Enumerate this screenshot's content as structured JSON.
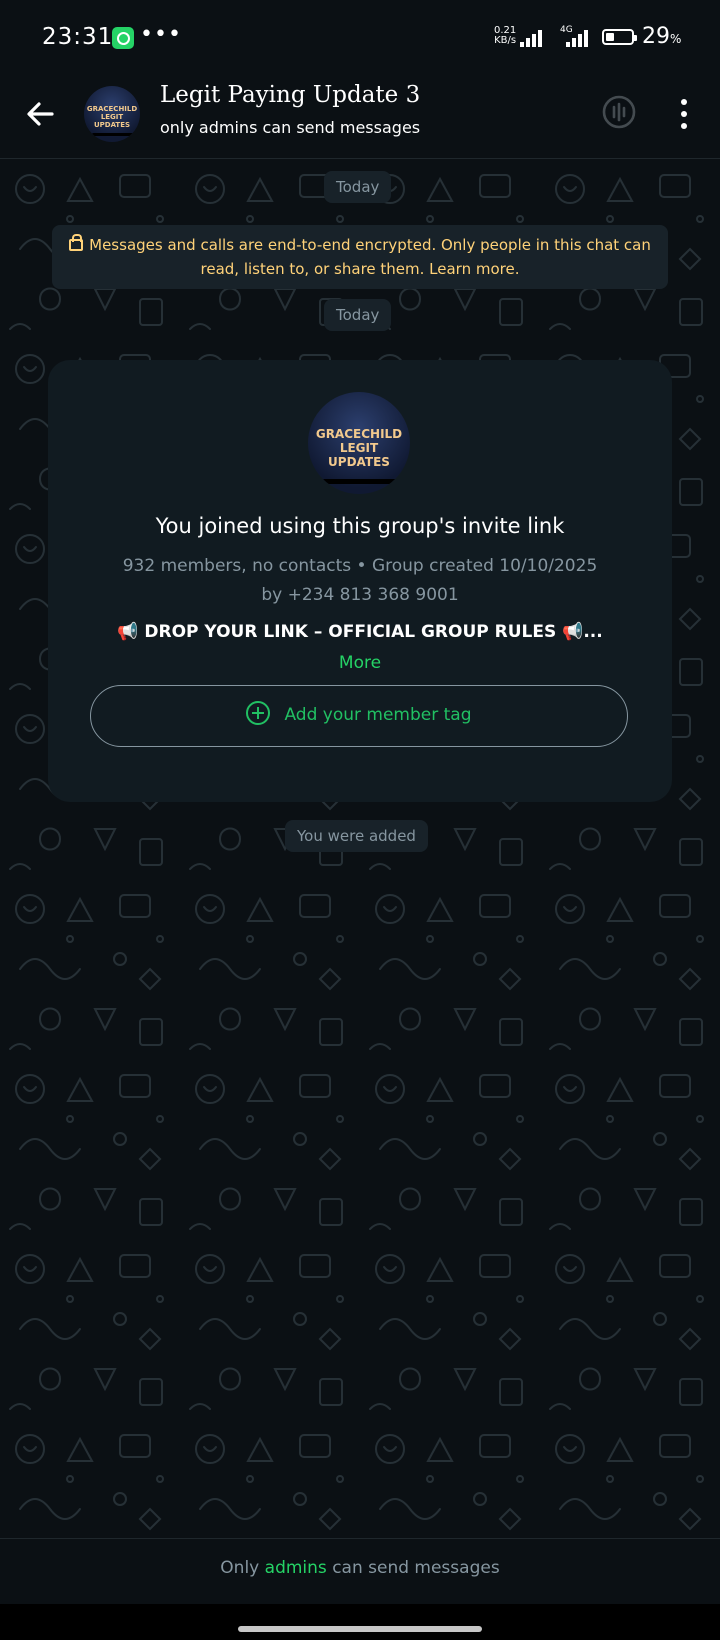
{
  "status_bar": {
    "time": "23:31",
    "more": "•••",
    "net_speed": "0.21",
    "net_unit": "KB/s",
    "network": "4G",
    "battery_value": "29",
    "battery_unit": "%"
  },
  "header": {
    "title": "Legit Paying Update 3",
    "subtitle": "only admins can send messages",
    "avatar_text": "GRACECHILD LEGIT UPDATES",
    "icons": [
      "back-arrow-icon",
      "voice-chat-icon",
      "more-vert-icon"
    ]
  },
  "chat": {
    "date_label_1": "Today",
    "encryption_notice": "Messages and calls are end-to-end encrypted. Only people in this chat can read, listen to, or share them. Learn more.",
    "date_label_2": "Today",
    "group_card": {
      "avatar_text": "GRACECHILD LEGIT UPDATES",
      "title": "You joined using this group's invite link",
      "info_line_1": "932 members, no contacts • Group created 10/10/2025",
      "info_line_2": "by +234 813 368 9001",
      "description": "📢 DROP YOUR LINK – OFFICIAL GROUP RULES 📢...",
      "more_label": "More",
      "member_tag_label": "Add your member tag"
    },
    "system_message": "You were added"
  },
  "footer": {
    "text_before": "Only",
    "admins_word": "admins",
    "text_after": "can send messages"
  },
  "colors": {
    "background": "#0b1014",
    "bubble": "#182229",
    "card": "#111b21",
    "accent_green": "#25d366",
    "encryption_yellow": "#ffd279",
    "muted_text": "#8696a0"
  }
}
